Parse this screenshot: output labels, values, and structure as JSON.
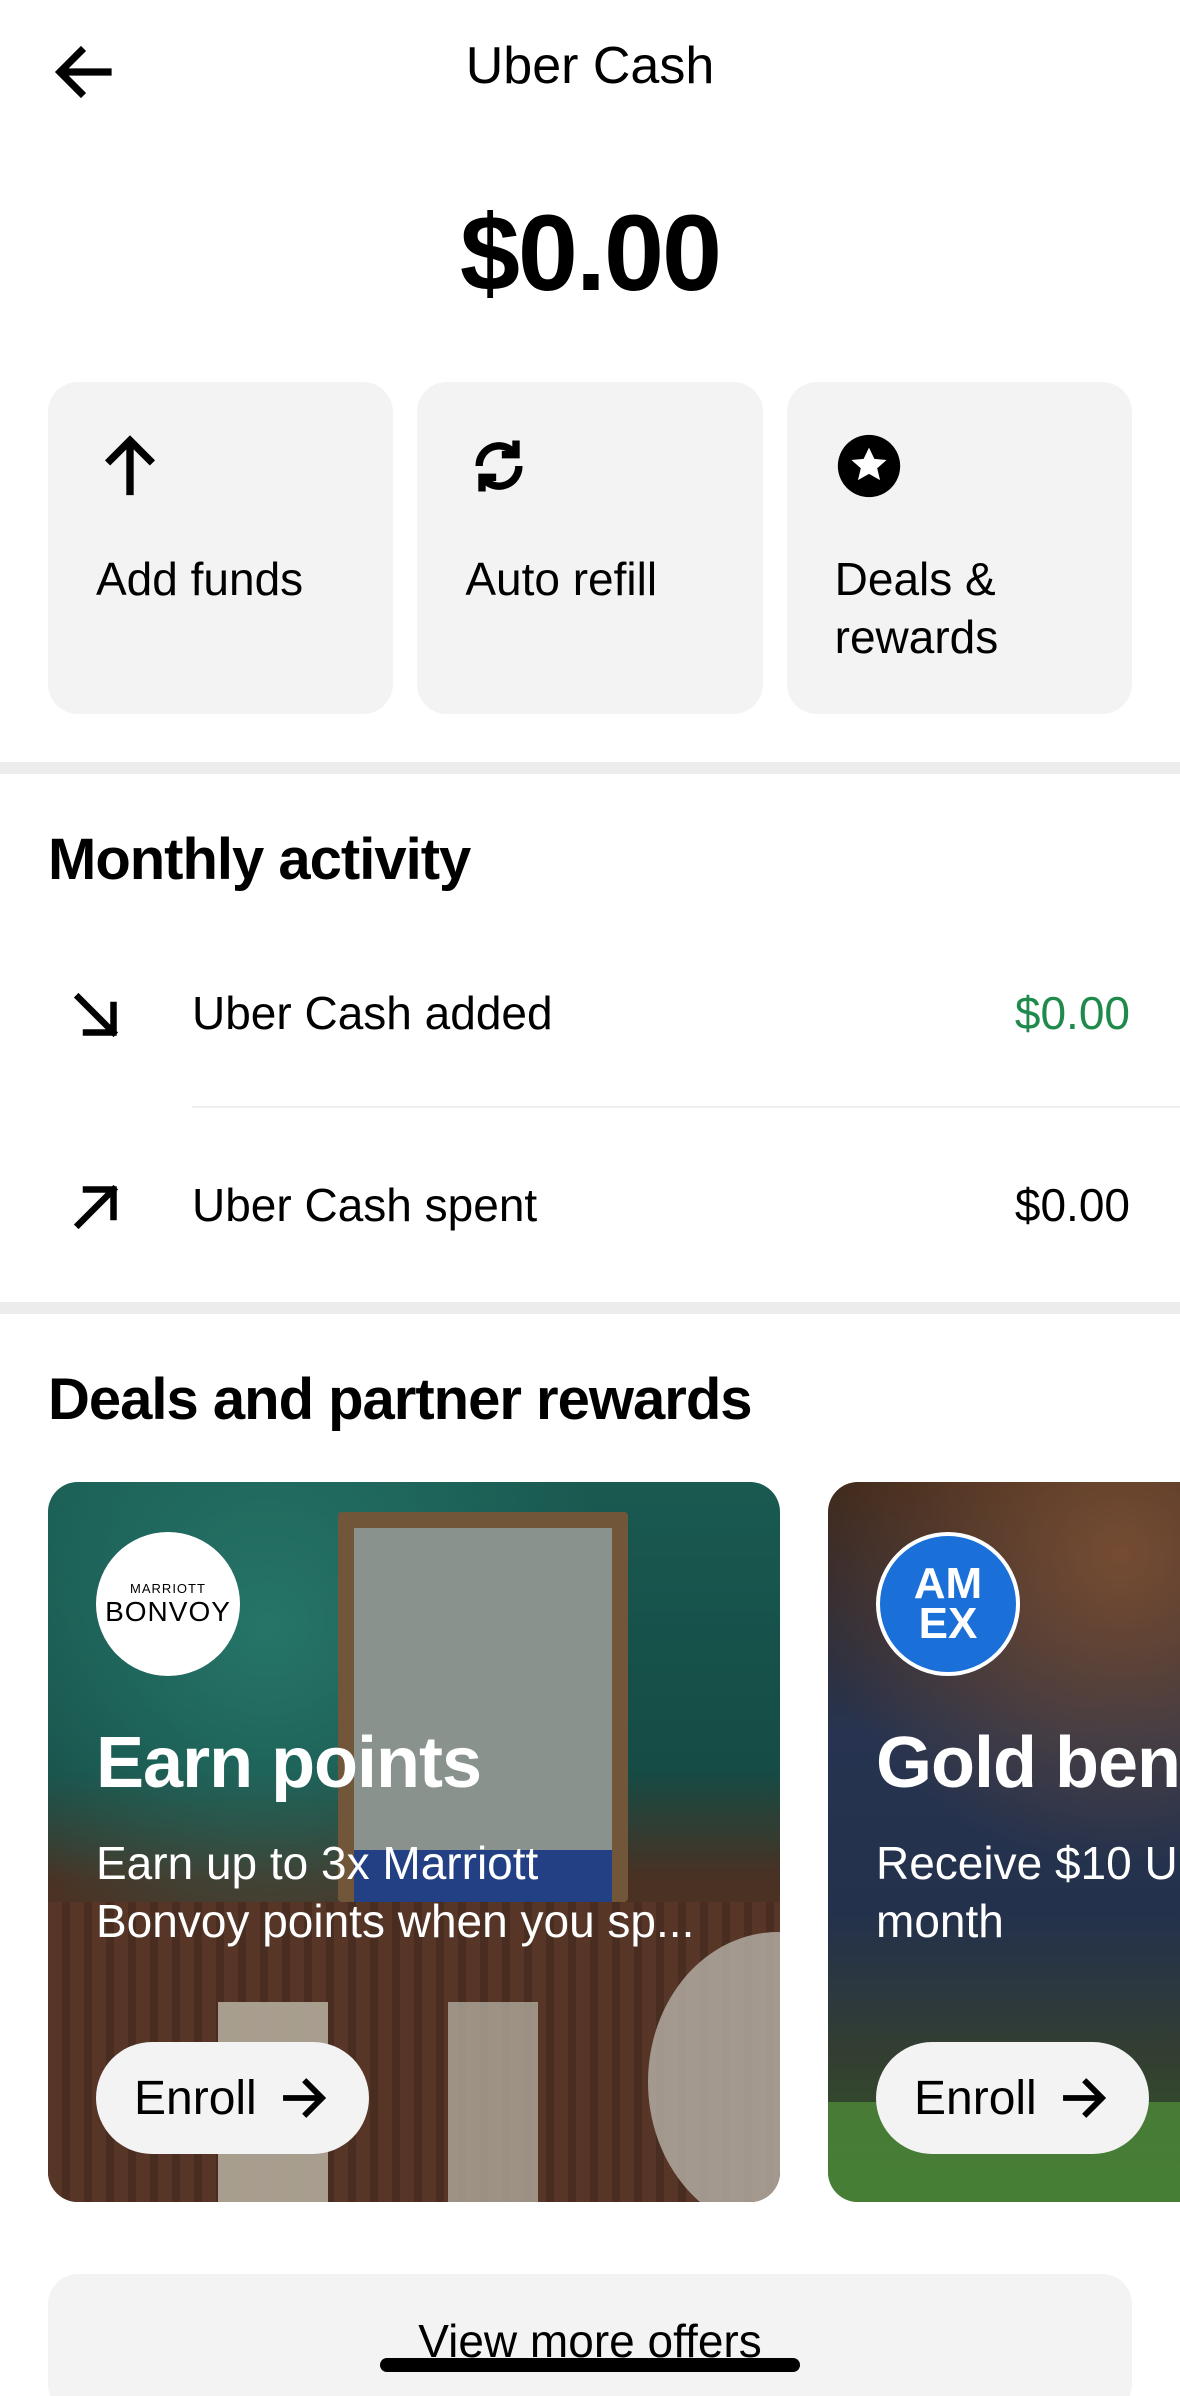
{
  "header": {
    "title": "Uber Cash",
    "back_icon": "arrow-left-icon"
  },
  "balance": "$0.00",
  "actions": [
    {
      "label": "Add funds",
      "icon": "arrow-up-icon"
    },
    {
      "label": "Auto refill",
      "icon": "refresh-icon"
    },
    {
      "label": "Deals & rewards",
      "icon": "star-circle-icon"
    }
  ],
  "monthly": {
    "title": "Monthly activity",
    "rows": [
      {
        "label": "Uber Cash added",
        "amount": "$0.00",
        "icon": "arrow-down-right-icon",
        "amount_color": "#1f8a4c"
      },
      {
        "label": "Uber Cash spent",
        "amount": "$0.00",
        "icon": "arrow-up-right-icon",
        "amount_color": "#000000"
      }
    ]
  },
  "deals": {
    "title": "Deals and partner rewards",
    "cards": [
      {
        "logo_small": "MARRIOTT",
        "logo_big": "BONVOY",
        "title": "Earn points",
        "desc_line1": "Earn up to 3x Marriott",
        "desc_line2": "Bonvoy points when you sp...",
        "button": "Enroll"
      },
      {
        "logo_top": "AM",
        "logo_bottom": "EX",
        "title": "Gold ben",
        "desc_line1": "Receive $10 U",
        "desc_line2": "month",
        "button": "Enroll"
      }
    ]
  },
  "view_more": "View more offers",
  "colors": {
    "tile_bg": "#f3f3f3",
    "green": "#1f8a4c",
    "amex_blue": "#1a6fd8"
  }
}
